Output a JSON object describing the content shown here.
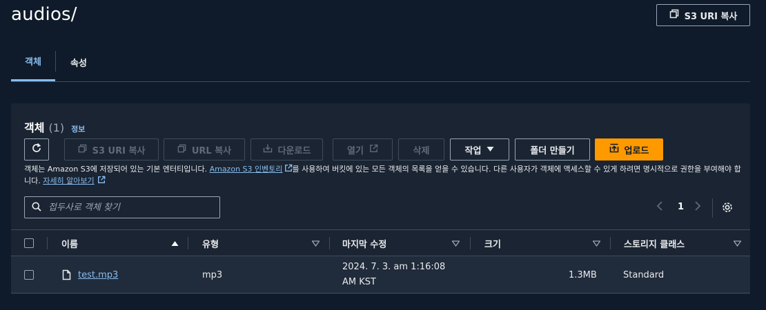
{
  "header": {
    "title": "audios/",
    "copy_s3_uri_label": "S3 URI 복사"
  },
  "tabs": [
    {
      "label": "객체",
      "active": true
    },
    {
      "label": "속성",
      "active": false
    }
  ],
  "panel": {
    "title": "객체",
    "count": "(1)",
    "info_label": "정보",
    "toolbar": {
      "refresh_icon": "refresh-icon",
      "copy_s3_uri_label": "S3 URI 복사",
      "copy_url_label": "URL 복사",
      "download_label": "다운로드",
      "open_label": "열기",
      "delete_label": "삭제",
      "actions_label": "작업",
      "create_folder_label": "폴더 만들기",
      "upload_label": "업로드"
    },
    "description": {
      "part1": "객체는 Amazon S3에 저장되어 있는 기본 엔터티입니다. ",
      "inventory_link": "Amazon S3 인벤토리",
      "part2": "를 사용하여 버킷에 있는 모든 객체의 목록을 얻을 수 있습니다. 다른 사용자가 객체에 액세스할 수 있게 하려면 명시적으로 권한을 부여해야 합니다. ",
      "learn_more_link": "자세히 알아보기"
    },
    "search": {
      "placeholder": "접두사로 객체 찾기",
      "value": ""
    },
    "pagination": {
      "current_page": "1"
    },
    "table": {
      "columns": [
        "이름",
        "유형",
        "마지막 수정",
        "크기",
        "스토리지 클래스"
      ],
      "rows": [
        {
          "name": "test.mp3",
          "type": "mp3",
          "last_modified_line1": "2024. 7. 3. am 1:16:08",
          "last_modified_line2": "AM KST",
          "size": "1.3MB",
          "storage_class": "Standard"
        }
      ]
    }
  },
  "colors": {
    "background": "#0f1b2a",
    "panel": "#1a2432",
    "accent_link": "#89bdee",
    "primary_button": "#ff9900"
  }
}
